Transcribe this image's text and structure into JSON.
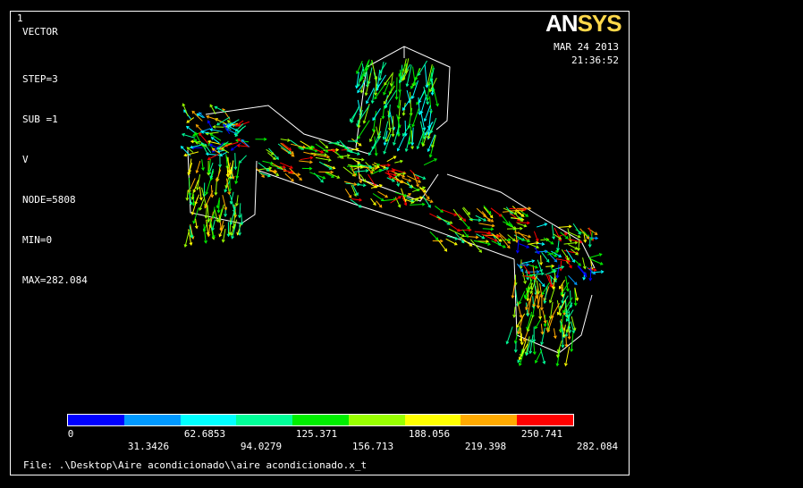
{
  "header": {
    "window_number": "1",
    "plot_type": "VECTOR",
    "info_lines": [
      "STEP=3",
      "SUB =1",
      "V",
      "NODE=5808",
      "MIN=0",
      "MAX=282.084"
    ],
    "logo_a": "AN",
    "logo_b": "SYS",
    "date": "MAR 24 2013",
    "time": "21:36:52"
  },
  "legend": {
    "colors": [
      "#0000ff",
      "#0099ff",
      "#00ffff",
      "#00ff99",
      "#00ee00",
      "#99ff00",
      "#ffff00",
      "#ffaa00",
      "#ff0000"
    ],
    "labels_top": [
      "0",
      "62.6853",
      "125.371",
      "188.056",
      "250.741"
    ],
    "labels_bottom": [
      "31.3426",
      "94.0279",
      "156.713",
      "219.398",
      "282.084"
    ]
  },
  "footer": {
    "file": "File: .\\Desktop\\Aire acondicionado\\\\aire acondicionado.x_t"
  }
}
